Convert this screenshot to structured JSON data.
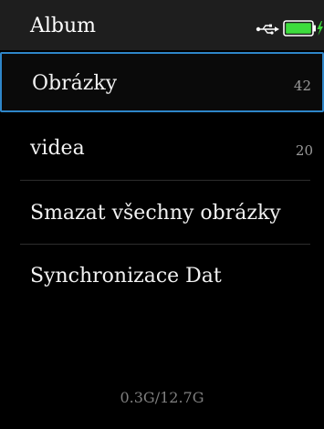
{
  "header": {
    "title": "Album",
    "usb_icon": "usb-icon",
    "battery_icon": "battery-charging-icon",
    "battery_color": "#3ddc3d"
  },
  "menu": {
    "items": [
      {
        "label": "Obrázky",
        "count": "42",
        "selected": true
      },
      {
        "label": "videa",
        "count": "20",
        "selected": false
      },
      {
        "label": "Smazat všechny obrázky",
        "count": "",
        "selected": false
      },
      {
        "label": "Synchronizace Dat",
        "count": "",
        "selected": false
      }
    ]
  },
  "footer": {
    "storage": "0.3G/12.7G"
  },
  "colors": {
    "accent": "#2e86c9",
    "header_bg": "#1e1e1e",
    "background": "#000000"
  }
}
